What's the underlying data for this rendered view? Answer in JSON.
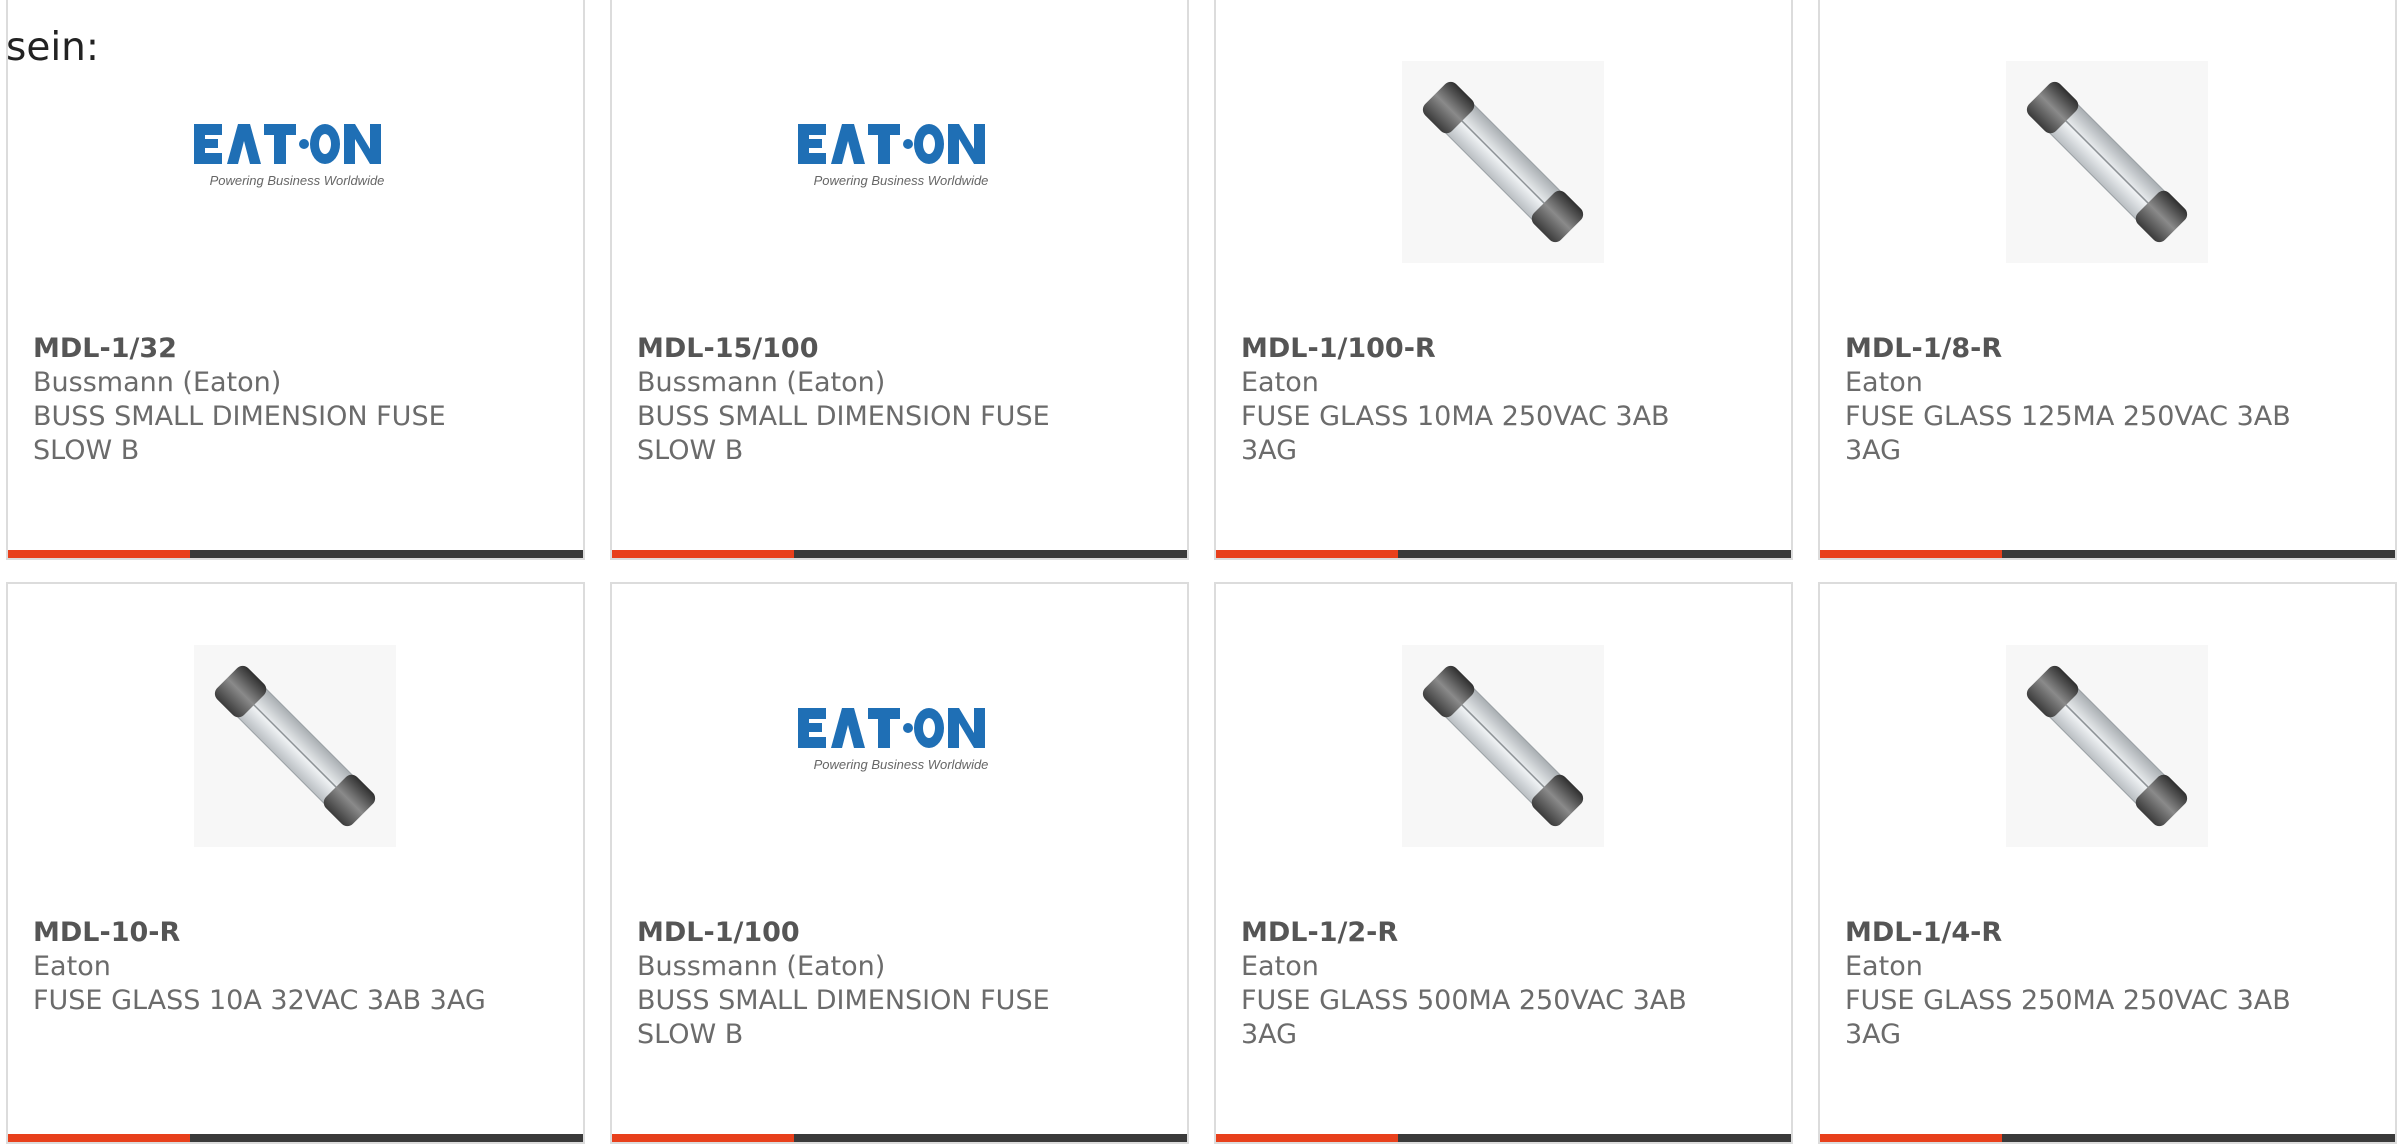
{
  "intro_text": "sein:",
  "logo_brand_text": "E·T·N",
  "logo_tagline": "Powering Business Worldwide",
  "colors": {
    "accent": "#e8401c",
    "bar": "#3a3a3a",
    "eaton_blue": "#1f6fb5"
  },
  "products": [
    {
      "part_number": "MDL-1/32",
      "manufacturer": "Bussmann (Eaton)",
      "description": "BUSS SMALL DIMENSION FUSE SLOW B",
      "image": "eaton-logo"
    },
    {
      "part_number": "MDL-15/100",
      "manufacturer": "Bussmann (Eaton)",
      "description": "BUSS SMALL DIMENSION FUSE SLOW B",
      "image": "eaton-logo"
    },
    {
      "part_number": "MDL-1/100-R",
      "manufacturer": "Eaton",
      "description": "FUSE GLASS 10MA 250VAC 3AB 3AG",
      "image": "glass-fuse"
    },
    {
      "part_number": "MDL-1/8-R",
      "manufacturer": "Eaton",
      "description": "FUSE GLASS 125MA 250VAC 3AB 3AG",
      "image": "glass-fuse"
    },
    {
      "part_number": "MDL-10-R",
      "manufacturer": "Eaton",
      "description": "FUSE GLASS 10A 32VAC 3AB 3AG",
      "image": "glass-fuse"
    },
    {
      "part_number": "MDL-1/100",
      "manufacturer": "Bussmann (Eaton)",
      "description": "BUSS SMALL DIMENSION FUSE SLOW B",
      "image": "eaton-logo"
    },
    {
      "part_number": "MDL-1/2-R",
      "manufacturer": "Eaton",
      "description": "FUSE GLASS 500MA 250VAC 3AB 3AG",
      "image": "glass-fuse"
    },
    {
      "part_number": "MDL-1/4-R",
      "manufacturer": "Eaton",
      "description": "FUSE GLASS 250MA 250VAC 3AB 3AG",
      "image": "glass-fuse"
    }
  ]
}
